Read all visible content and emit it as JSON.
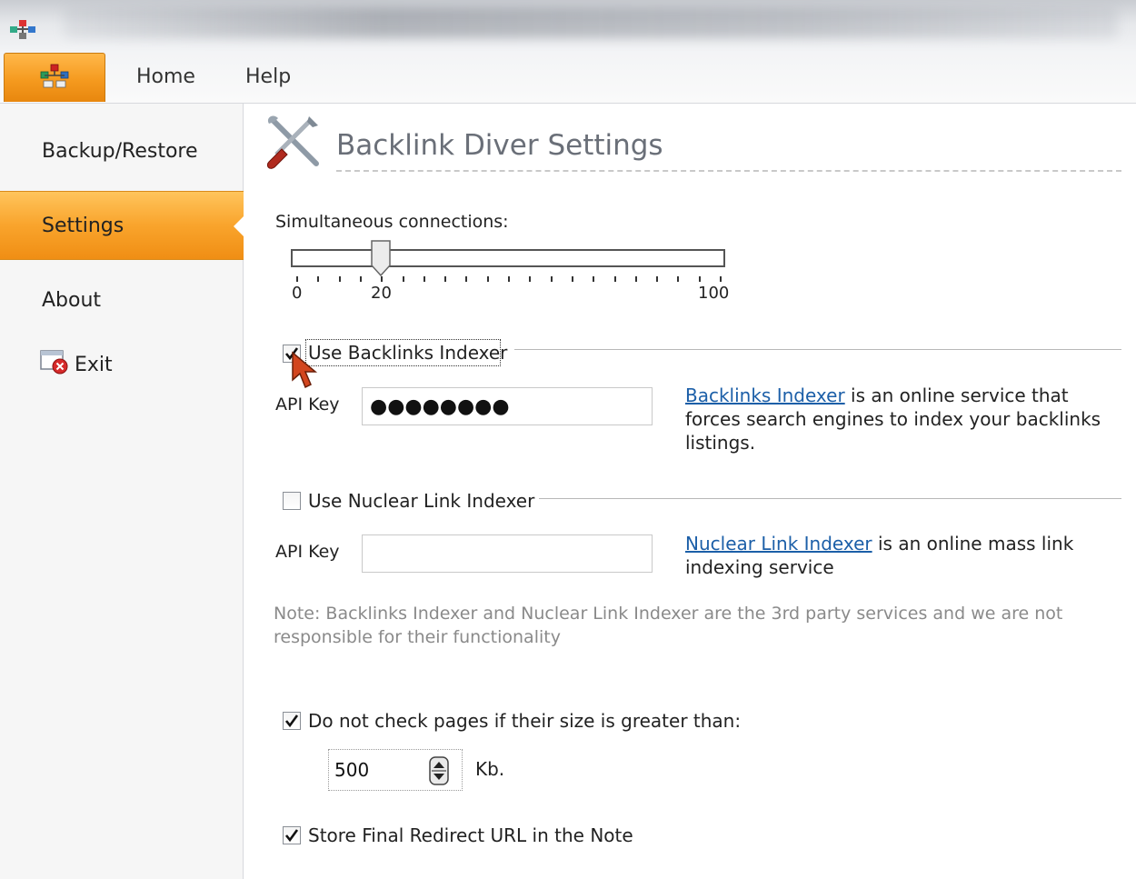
{
  "window": {
    "app_icon": "network-nodes-icon"
  },
  "ribbon": {
    "app_button_icon": "network-nodes-icon",
    "tabs": [
      {
        "label": "Home"
      },
      {
        "label": "Help"
      }
    ],
    "accent": "#f59a1f"
  },
  "sidebar": {
    "items": [
      {
        "label": "Backup/Restore",
        "active": false
      },
      {
        "label": "Settings",
        "active": true
      },
      {
        "label": "About",
        "active": false
      }
    ],
    "exit": {
      "label": "Exit",
      "icon": "exit-window-icon"
    }
  },
  "settings": {
    "header_icon": "tools-icon",
    "title": "Backlink Diver Settings",
    "connections": {
      "label": "Simultaneous connections:",
      "min_label": "0",
      "mark_label": "20",
      "max_label": "100",
      "value": 20
    },
    "backlinks_indexer": {
      "checked": true,
      "label": "Use Backlinks Indexer",
      "api_key_label": "API Key",
      "api_key_value": "●●●●●●●●",
      "link_text": "Backlinks Indexer",
      "description": " is an online service that forces search engines to index your backlinks listings."
    },
    "nuclear_indexer": {
      "checked": false,
      "label": "Use Nuclear Link Indexer",
      "api_key_label": "API Key",
      "api_key_value": "",
      "link_text": "Nuclear Link Indexer",
      "description": "  is an online mass link indexing service"
    },
    "note": "Note: Backlinks Indexer and Nuclear Link Indexer are the 3rd party services and we are not responsible for their functionality",
    "size_limit": {
      "checked": true,
      "label": "Do not check pages if their size is greater than:",
      "value": "500",
      "unit": "Kb."
    },
    "store_redirect": {
      "checked": true,
      "label": "Store Final Redirect URL in the Note"
    }
  }
}
